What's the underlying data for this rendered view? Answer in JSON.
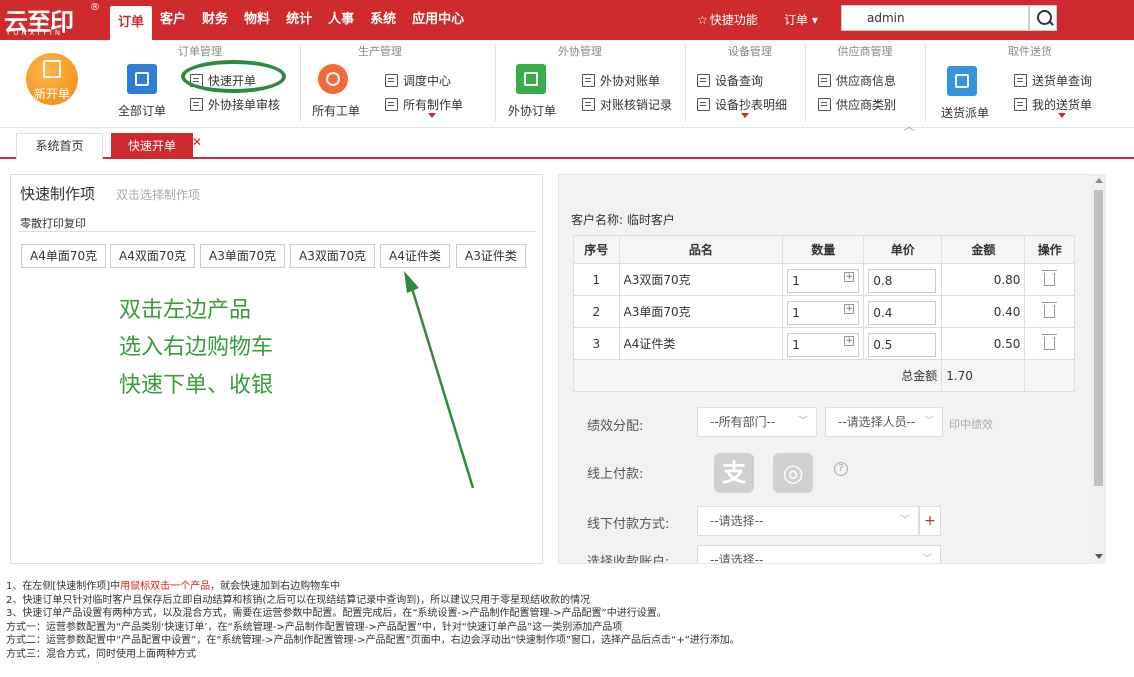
{
  "brand": {
    "logo_text": "云至印",
    "logo_sub": "YUNXIYIN",
    "logo_reg": "®"
  },
  "nav": [
    {
      "label": "订单",
      "active": true
    },
    {
      "label": "客户",
      "active": false
    },
    {
      "label": "财务",
      "active": false
    },
    {
      "label": "物料",
      "active": false
    },
    {
      "label": "统计",
      "active": false
    },
    {
      "label": "人事",
      "active": false
    },
    {
      "label": "系统",
      "active": false
    },
    {
      "label": "应用中心",
      "active": false
    }
  ],
  "header": {
    "quick_functions": "快捷功能",
    "search_scope": "订单",
    "search_value": "admin"
  },
  "ribbon": {
    "groups": {
      "order": "订单管理",
      "production": "生产管理",
      "outsource": "外协管理",
      "equipment": "设备管理",
      "supplier": "供应商管理",
      "delivery": "取件送货"
    },
    "new_order": "新开单",
    "all_orders": "全部订单",
    "quick_order": "快速开单",
    "outsource_review": "外协接单审核",
    "all_work_orders": "所有工单",
    "dispatch_center": "调度中心",
    "all_production_orders": "所有制作单",
    "outsource_orders": "外协订单",
    "outsource_statement": "外协对账单",
    "reconcile_records": "对账核销记录",
    "equipment_query": "设备查询",
    "meter_details": "设备抄表明细",
    "supplier_info": "供应商信息",
    "supplier_category": "供应商类别",
    "delivery_dispatch": "送货派单",
    "delivery_query": "送货单查询",
    "my_delivery": "我的送货单"
  },
  "tabs": [
    {
      "label": "系统首页",
      "active": false
    },
    {
      "label": "快速开单",
      "active": true
    }
  ],
  "left": {
    "title": "快速制作项",
    "subtitle": "双击选择制作项",
    "category": "零散打印复印",
    "products": [
      "A4单面70克",
      "A4双面70克",
      "A3单面70克",
      "A3双面70克",
      "A4证件类",
      "A3证件类"
    ],
    "hint_lines": [
      "双击左边产品",
      "选入右边购物车",
      "快速下单、收银"
    ]
  },
  "cart": {
    "customer_label": "客户名称:",
    "customer_name": "临时客户",
    "headers": [
      "序号",
      "品名",
      "数量",
      "单价",
      "金额",
      "操作"
    ],
    "rows": [
      {
        "no": "1",
        "name": "A3双面70克",
        "qty": "1",
        "price": "0.8",
        "amount": "0.80"
      },
      {
        "no": "2",
        "name": "A3单面70克",
        "qty": "1",
        "price": "0.4",
        "amount": "0.40"
      },
      {
        "no": "3",
        "name": "A4证件类",
        "qty": "1",
        "price": "0.5",
        "amount": "0.50"
      }
    ],
    "total_label": "总金额",
    "total_value": "1.70"
  },
  "form": {
    "performance_label": "绩效分配:",
    "dept_select": "--所有部门--",
    "person_select": "--请选择人员--",
    "print_performance": "印中绩效",
    "online_pay_label": "线上付款:",
    "alipay_glyph": "支",
    "offline_pay_label": "线下付款方式:",
    "offline_select": "--请选择--",
    "account_label": "选择收款账户:",
    "account_select": "--请选择--"
  },
  "notes": [
    {
      "pre": "1、在左侧[快速制作项]中",
      "red": "用鼠标双击一个产品",
      "post": "，就会快速加到右边购物车中"
    },
    {
      "pre": "2、快速订单只针对临时客户且保存后立即自动结算和核销(之后可以在现结结算记录中查询到)，所以建议只用于零星现结收款的情况",
      "red": "",
      "post": ""
    },
    {
      "pre": "3、快速订单产品设置有两种方式，以及混合方式，需要在运营参数中配置。配置完成后，在“系统设置->产品制作配置管理->产品配置”中进行设置。",
      "red": "",
      "post": ""
    },
    {
      "pre": "方式一：运营参数配置为“产品类别‘快速订单’，在“系统管理->产品制作配置管理->产品配置”中，针对“快速订单产品”这一类别添加产品项",
      "red": "",
      "post": ""
    },
    {
      "pre": "方式二：运营参数配置中“产品配置中设置”，在“系统管理->产品制作配置管理->产品配置”页面中，右边会浮动出“快速制作项”窗口，选择产品后点击“+”进行添加。",
      "red": "",
      "post": ""
    },
    {
      "pre": "方式三：混合方式，同时使用上面两种方式",
      "red": "",
      "post": ""
    }
  ],
  "colors": {
    "brand_red": "#cf2a2e",
    "annotation_green": "#3a9c3a"
  }
}
